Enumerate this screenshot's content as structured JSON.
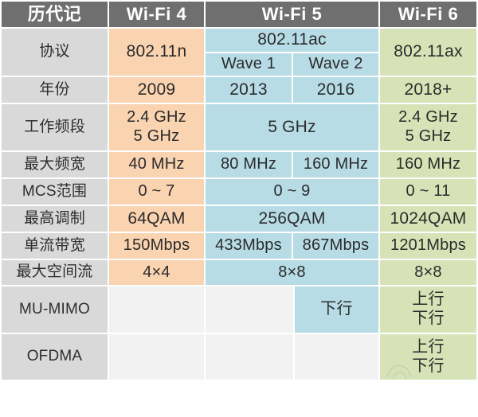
{
  "table": {
    "header": {
      "label_col": "历代记",
      "columns": [
        "Wi-Fi 4",
        "Wi-Fi 5",
        "Wi-Fi 6"
      ]
    },
    "rows": [
      {
        "label": "协议",
        "wifi4": "802.11n",
        "wifi5_merged": "802.11ac",
        "wifi5_wave1": "Wave 1",
        "wifi5_wave2": "Wave 2",
        "wifi6": "802.11ax"
      },
      {
        "label": "年份",
        "wifi4": "2009",
        "wifi5_wave1": "2013",
        "wifi5_wave2": "2016",
        "wifi6": "2018+"
      },
      {
        "label": "工作频段",
        "wifi4_line1": "2.4 GHz",
        "wifi4_line2": "5 GHz",
        "wifi5_merged": "5 GHz",
        "wifi6_line1": "2.4 GHz",
        "wifi6_line2": "5 GHz"
      },
      {
        "label": "最大频宽",
        "wifi4": "40 MHz",
        "wifi5_wave1": "80 MHz",
        "wifi5_wave2": "160 MHz",
        "wifi6": "160 MHz"
      },
      {
        "label": "MCS范围",
        "wifi4": "0 ~ 7",
        "wifi5_merged": "0 ~ 9",
        "wifi6": "0 ~ 11"
      },
      {
        "label": "最高调制",
        "wifi4": "64QAM",
        "wifi5_merged": "256QAM",
        "wifi6": "1024QAM"
      },
      {
        "label": "单流带宽",
        "wifi4": "150Mbps",
        "wifi5_wave1": "433Mbps",
        "wifi5_wave2": "867Mbps",
        "wifi6": "1201Mbps"
      },
      {
        "label": "最大空间流",
        "wifi4": "4×4",
        "wifi5_merged": "8×8",
        "wifi6": "8×8"
      },
      {
        "label": "MU-MIMO",
        "wifi4": "",
        "wifi5_wave1": "",
        "wifi5_wave2": "下行",
        "wifi6_line1": "上行",
        "wifi6_line2": "下行"
      },
      {
        "label": "OFDMA",
        "wifi4": "",
        "wifi5_wave1": "",
        "wifi5_wave2": "",
        "wifi6_line1": "上行",
        "wifi6_line2": "下行"
      }
    ]
  },
  "colors": {
    "header_gray": "#706f6f",
    "label_gray": "#d9d9d9",
    "wifi4_orange": "#fad3b0",
    "wifi5_blue": "#b7dce6",
    "wifi6_green": "#d7e3b6",
    "empty_gray": "#f2f2f2",
    "text_dark": "#2b2b2b"
  }
}
